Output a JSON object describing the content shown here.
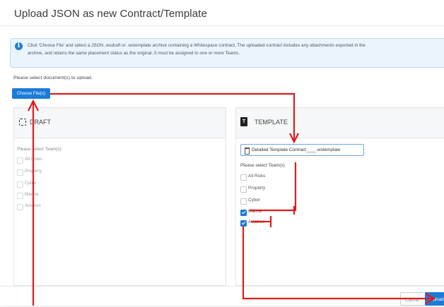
{
  "dialog": {
    "title": "Upload JSON as new Contract/Template"
  },
  "info": {
    "line1": "Click 'Choose File' and select a JSON .wsdraft or .wstemplate archive containing a Whitespace contract. The uploaded contract includes any attachments exported in the",
    "line2": "archive, and retains the same placement status as the original. It must be assigned to one or more Teams."
  },
  "select_docs_label": "Please select document(s) to upload.",
  "choose_button_label": "Choose File(s)",
  "draft": {
    "title": "DRAFT",
    "team_label": "Please select Team(s)",
    "teams": [
      {
        "label": "All Risks",
        "checked": false
      },
      {
        "label": "Property",
        "checked": false
      },
      {
        "label": "Cyber",
        "checked": false
      },
      {
        "label": "Marine",
        "checked": false
      },
      {
        "label": "Aviation",
        "checked": false
      }
    ]
  },
  "template": {
    "title": "TEMPLATE",
    "file_name": "Detailed Template Contract____.wstemplate",
    "team_label": "Please select Team(s)",
    "teams": [
      {
        "label": "All Risks",
        "checked": false
      },
      {
        "label": "Property",
        "checked": false
      },
      {
        "label": "Cyber",
        "checked": false
      },
      {
        "label": "Marine",
        "checked": true
      },
      {
        "label": "Aviation",
        "checked": true
      }
    ]
  },
  "footer": {
    "cancel_label": "Cancel",
    "upload_label": "Upload"
  },
  "colors": {
    "accent": "#1b7bd8",
    "annotation": "#e01b1b"
  }
}
